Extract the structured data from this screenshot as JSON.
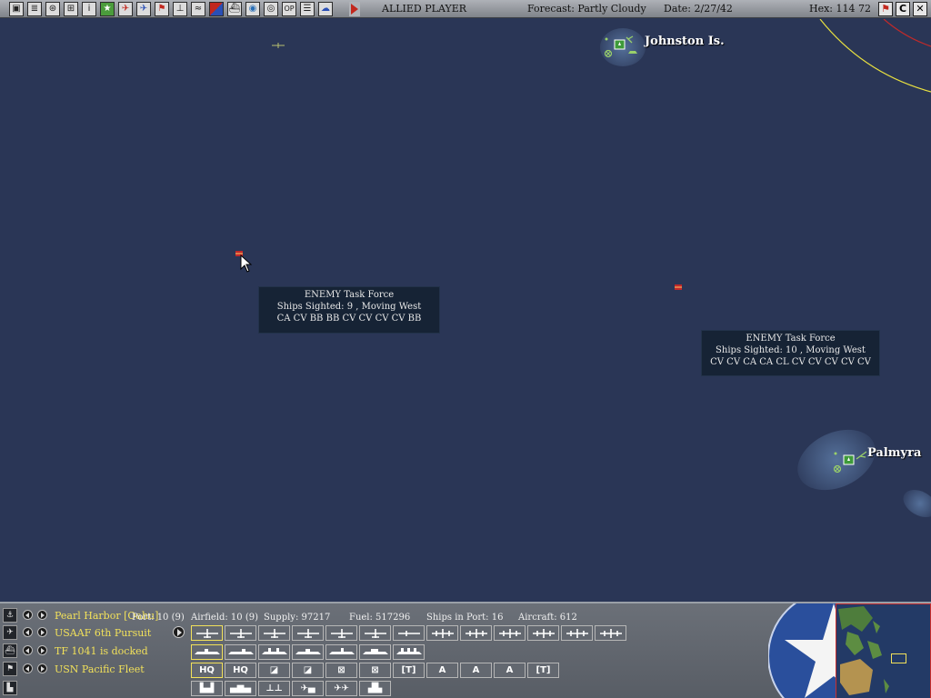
{
  "topbar": {
    "player": "ALLIED PLAYER",
    "forecast": "Forecast: Partly Cloudy",
    "date": "Date: 2/27/42",
    "hex": "Hex: 114 72",
    "tool_icons": [
      "save-icon",
      "document-icon",
      "bomb-icon",
      "ship-group-icon",
      "info-icon",
      "star-icon",
      "plane-red-icon",
      "plane-blue-icon",
      "flag-icon",
      "land-unit-icon",
      "route-icon",
      "red-blue-icon",
      "ship-icon",
      "globe-icon",
      "target-icon",
      "op-icon",
      "list-icon",
      "cloud-icon"
    ],
    "op_label": "OP",
    "info_label": "i",
    "right_buttons": {
      "flag": "⚑",
      "c": "C",
      "x": "✕"
    }
  },
  "map": {
    "bases": [
      {
        "name": "Johnston Is."
      },
      {
        "name": "Palmyra"
      }
    ],
    "task_forces": [
      {
        "title": "ENEMY Task Force",
        "sighted": "Ships Sighted: 9 , Moving West",
        "ships": "CA CV BB BB CV CV CV CV BB"
      },
      {
        "title": "ENEMY Task Force",
        "sighted": "Ships Sighted: 10 , Moving West",
        "ships": "CV CV CA CA CL CV CV CV CV CV"
      }
    ],
    "colors": {
      "ocean": "#2a3656",
      "enemy": "#c0282a",
      "range_yellow": "#e8e040",
      "range_red": "#c02a2a"
    }
  },
  "bottom": {
    "rows": [
      {
        "icon": "anchor-icon",
        "text": "Pearl Harbor [Oahu]"
      },
      {
        "icon": "air-group-icon",
        "text": "USAAF 6th Pursuit"
      },
      {
        "icon": "task-force-icon",
        "text": "TF 1041 is docked"
      },
      {
        "icon": "hq-flag-icon",
        "text": "USN Pacific Fleet"
      },
      {
        "icon": "factory-icon",
        "text": ""
      }
    ],
    "stats": {
      "port": "Port: 10 (9)",
      "airfield": "Airfield: 10 (9)",
      "supply": "Supply: 97217",
      "fuel": "Fuel: 517296",
      "ships_in_port": "Ships in Port: 16",
      "aircraft": "Aircraft: 612"
    },
    "slot_labels": {
      "hq": "HQ",
      "bracket": "[T]",
      "a": "A"
    }
  }
}
